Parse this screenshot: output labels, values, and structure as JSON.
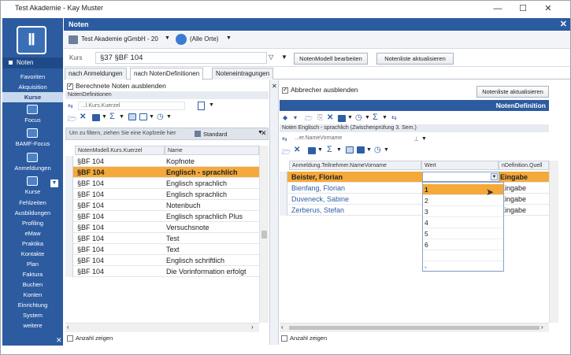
{
  "window": {
    "title": "Test Akademie - Kay Muster"
  },
  "nav": {
    "active_section": "Noten",
    "items": [
      {
        "label": "Favoriten"
      },
      {
        "label": "Akquisition"
      },
      {
        "label": "Kurse",
        "selected": true
      },
      {
        "label": "Focus"
      },
      {
        "label": "BAMF-Focus"
      },
      {
        "label": "Anmeldungen"
      },
      {
        "label": "Kurse"
      },
      {
        "label": "Fehlzeiten"
      },
      {
        "label": "Ausbildungen"
      },
      {
        "label": "Profiling"
      },
      {
        "label": "eMaw"
      },
      {
        "label": "Praktika"
      },
      {
        "label": "Kontakte"
      },
      {
        "label": "Plan"
      },
      {
        "label": "Faktura"
      },
      {
        "label": "Buchen"
      },
      {
        "label": "Konten"
      },
      {
        "label": "Einrichtung"
      },
      {
        "label": "System"
      },
      {
        "label": "weitere"
      }
    ]
  },
  "header": {
    "title": "Noten"
  },
  "toolbar": {
    "org": "Test Akademie gGmbH - 20",
    "location": "(Alle Orte)",
    "kurs_label": "Kurs",
    "kurs_value": "§37 §BF 104",
    "btn_model": "NotenModell bearbeiten",
    "btn_refresh": "Notenliste aktualisieren"
  },
  "tabs": [
    {
      "label": "nach Anmeldungen"
    },
    {
      "label": "nach NotenDefinitionen",
      "active": true
    },
    {
      "label": "Noteneintragungen"
    }
  ],
  "left": {
    "checkbox_hide": "Berechnete Noten ausblenden",
    "panel_title": "NotenDefinitionen",
    "filter_field": "...l.Kurs.Kuerzel",
    "groupby_hint": "Um zu filtern, ziehen Sie eine Kopfzeile hier",
    "layout": "Standard",
    "columns": [
      "NotenModell.Kurs.Kuerzel",
      "Name"
    ],
    "rows": [
      {
        "kurs": "§BF 104",
        "name": "Kopfnote"
      },
      {
        "kurs": "§BF 104",
        "name": "Englisch - sprachlich"
      },
      {
        "kurs": "§BF 104",
        "name": "Englisch sprachlich"
      },
      {
        "kurs": "§BF 104",
        "name": "Englisch sprachlich"
      },
      {
        "kurs": "§BF 104",
        "name": "Notenbuch"
      },
      {
        "kurs": "§BF 104",
        "name": "Englisch sprachlich Plus"
      },
      {
        "kurs": "§BF 104",
        "name": "Versuchsnote"
      },
      {
        "kurs": "§BF 104",
        "name": "Test"
      },
      {
        "kurs": "§BF 104",
        "name": "Text"
      },
      {
        "kurs": "§BF 104",
        "name": "Englisch schriftlich"
      },
      {
        "kurs": "§BF 104",
        "name": "Die Vorinformation erfolgt"
      }
    ],
    "count_label": "Anzahl zeigen"
  },
  "right": {
    "checkbox_dropouts": "Abbrecher ausblenden",
    "btn_refresh": "Notenliste aktualisieren",
    "panel_title": "NotenDefinition",
    "subtitle": "Noten Englisch - sprachlich (Zwischenprüfung 3. Sem.)",
    "filter_field": "...er.NameVorname",
    "columns": [
      "Anmeldung.Teilnehmer.NameVorname",
      "Wert",
      "nDefinition.Quell"
    ],
    "rows": [
      {
        "name": "Beister, Florian",
        "quelle": "Eingabe"
      },
      {
        "name": "Bienfang, Florian",
        "quelle": "Eingabe"
      },
      {
        "name": "Duveneck, Sabine",
        "quelle": "Eingabe"
      },
      {
        "name": "Zerberus, Stefan",
        "quelle": "Eingabe"
      }
    ],
    "dropdown_options": [
      "1",
      "2",
      "3",
      "4",
      "5",
      "6",
      "",
      "-"
    ],
    "count_label": "Anzahl zeigen"
  }
}
